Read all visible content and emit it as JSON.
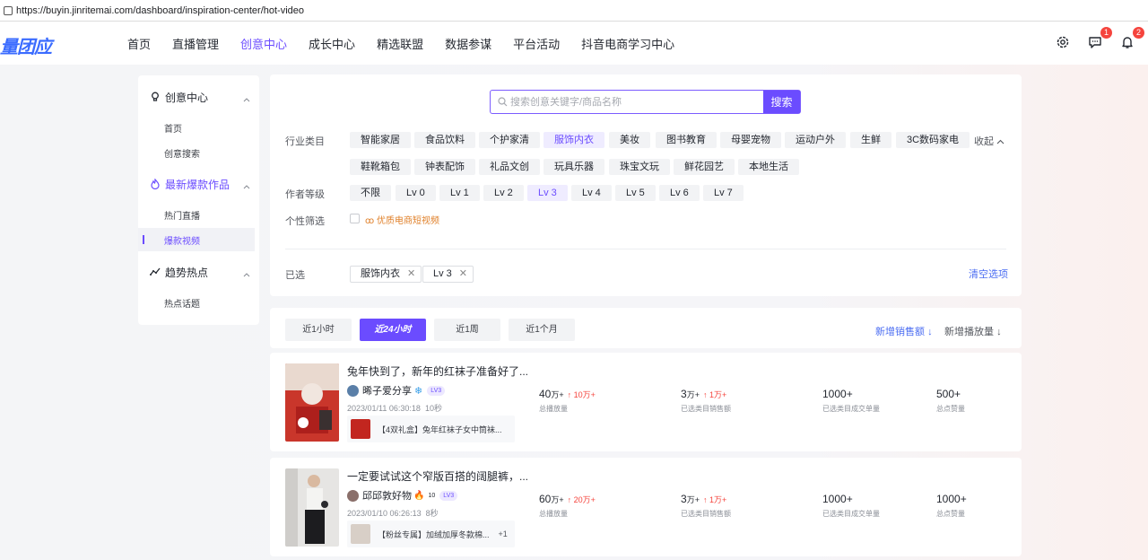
{
  "browser": {
    "url": "https://buyin.jinritemai.com/dashboard/inspiration-center/hot-video"
  },
  "nav": {
    "logo": "量团应",
    "items": [
      "首页",
      "直播管理",
      "创意中心",
      "成长中心",
      "精选联盟",
      "数据参谋",
      "平台活动",
      "抖音电商学习中心"
    ],
    "active_index": 2,
    "message_badge": "1",
    "notification_badge": "2"
  },
  "sidebar": {
    "groups": [
      {
        "label": "创意中心",
        "icon": "bulb-icon",
        "items": [
          "首页",
          "创意搜索"
        ]
      },
      {
        "label": "最新爆款作品",
        "icon": "flame-icon",
        "items": [
          "热门直播",
          "爆款视频"
        ]
      },
      {
        "label": "趋势热点",
        "icon": "trend-icon",
        "items": [
          "热点话题"
        ]
      }
    ],
    "active_item": "爆款视频"
  },
  "search": {
    "placeholder": "搜索创意关键字/商品名称",
    "button": "搜索"
  },
  "filters": {
    "industry_label": "行业类目",
    "industry_row1": [
      "智能家居",
      "食品饮料",
      "个护家清",
      "服饰内衣",
      "美妆",
      "图书教育",
      "母婴宠物",
      "运动户外",
      "生鲜",
      "3C数码家电"
    ],
    "industry_row2": [
      "鞋靴箱包",
      "钟表配饰",
      "礼品文创",
      "玩具乐器",
      "珠宝文玩",
      "鲜花园艺",
      "本地生活"
    ],
    "industry_active": "服饰内衣",
    "collapse": "收起",
    "level_label": "作者等级",
    "levels": [
      "不限",
      "Lv 0",
      "Lv 1",
      "Lv 2",
      "Lv 3",
      "Lv 4",
      "Lv 5",
      "Lv 6",
      "Lv 7"
    ],
    "level_active": "Lv 3",
    "personal_label": "个性筛选",
    "personal_option": "优质电商短视频",
    "personal_checked": false,
    "selected_label": "已选",
    "selected": [
      "服饰内衣",
      "Lv 3"
    ],
    "clear": "清空选项"
  },
  "time_tabs": [
    "近1小时",
    "近24小时",
    "近1周",
    "近1个月"
  ],
  "time_active": "近24小时",
  "sort": {
    "primary": "新增销售额",
    "secondary": "新增播放量"
  },
  "videos": [
    {
      "title": "兔年快到了，新年的红袜子准备好了...",
      "author": "晞子爱分享",
      "author_badge": "❄",
      "level": "LV3",
      "datetime": "2023/01/11 06:30:18",
      "duration": "10秒",
      "product": "【4双礼盒】兔年红袜子女中筒袜...",
      "stats": [
        {
          "value": "40",
          "unit": "万+",
          "delta": "10万+",
          "label": "总播放量"
        },
        {
          "value": "3",
          "unit": "万+",
          "delta": "1万+",
          "label": "已选类目销售额"
        },
        {
          "value": "1000+",
          "unit": "",
          "delta": "",
          "label": "已选类目成交单量"
        },
        {
          "value": "500+",
          "unit": "",
          "delta": "",
          "label": "总点赞量"
        }
      ]
    },
    {
      "title": "一定要试试这个窄版百搭的阔腿裤，...",
      "author": "邱邱敦好物",
      "author_badge": "🔥",
      "author_fans": "10",
      "level": "LV3",
      "datetime": "2023/01/10 06:26:13",
      "duration": "8秒",
      "product": "【粉丝专属】加绒加厚冬款棉...",
      "product_more": "+1",
      "stats": [
        {
          "value": "60",
          "unit": "万+",
          "delta": "20万+",
          "label": "总播放量"
        },
        {
          "value": "3",
          "unit": "万+",
          "delta": "1万+",
          "label": "已选类目销售额"
        },
        {
          "value": "1000+",
          "unit": "",
          "delta": "",
          "label": "已选类目成交单量"
        },
        {
          "value": "1000+",
          "unit": "",
          "delta": "",
          "label": "总点赞量"
        }
      ]
    }
  ]
}
